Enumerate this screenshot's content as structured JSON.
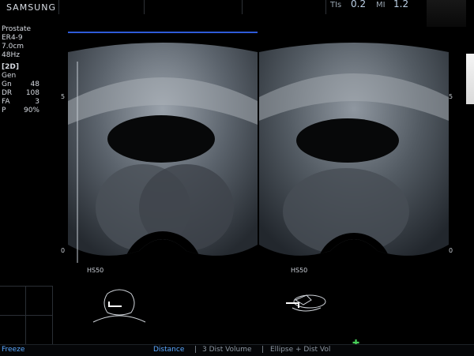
{
  "header": {
    "brand": "SAMSUNG",
    "tis_label": "TIs",
    "tis_value": "0.2",
    "mi_label": "MI",
    "mi_value": "1.2"
  },
  "info": {
    "preset": "Prostate",
    "probe": "ER4-9",
    "depth": "7.0cm",
    "framerate": "48Hz",
    "mode": "[2D]",
    "freq": "Gen",
    "params": [
      {
        "k": "Gn",
        "v": "48"
      },
      {
        "k": "DR",
        "v": "108"
      },
      {
        "k": "FA",
        "v": "3"
      },
      {
        "k": "P",
        "v": "90%"
      }
    ]
  },
  "scale_left": {
    "top": "5",
    "bottom": "0"
  },
  "scale_right": {
    "top": "5",
    "bottom": "0"
  },
  "image_left": {
    "label": "HS50"
  },
  "image_right": {
    "label": "HS50"
  },
  "softkeys": {
    "freeze": "Freeze",
    "distance": "Distance",
    "dist3": "3 Dist Volume",
    "ellipse": "Ellipse + Dist Vol"
  },
  "colors": {
    "accent": "#2e5ad8",
    "active_key": "#5aa8ff",
    "cursor": "#49d05a"
  }
}
